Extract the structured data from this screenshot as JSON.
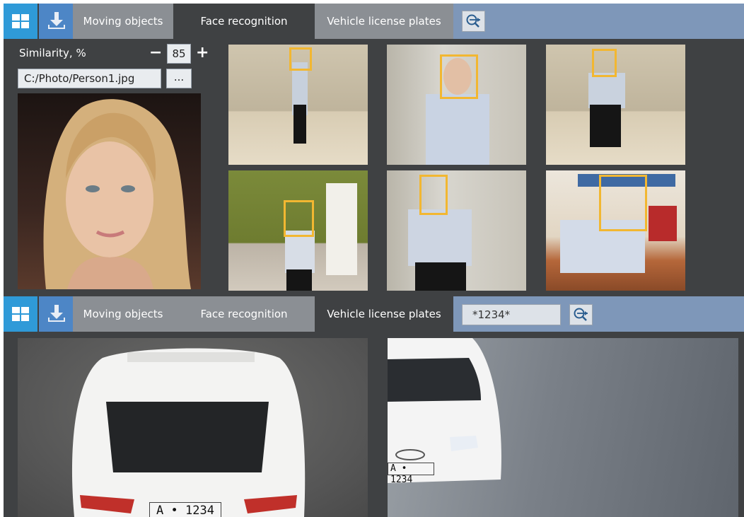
{
  "panel_top": {
    "tabs": [
      {
        "label": "Moving objects"
      },
      {
        "label": "Face recognition"
      },
      {
        "label": "Vehicle license plates"
      }
    ],
    "active_tab": "Face recognition"
  },
  "face_search": {
    "similarity_label": "Similarity, %",
    "similarity_value": "85",
    "minus": "−",
    "plus": "+",
    "file_path": "C:/Photo/Person1.jpg",
    "browse_label": "..."
  },
  "panel_bottom": {
    "tabs": [
      {
        "label": "Moving objects"
      },
      {
        "label": "Face recognition"
      },
      {
        "label": "Vehicle license plates"
      }
    ],
    "active_tab": "Vehicle license plates",
    "plate_query": "*1234*"
  },
  "plates": {
    "cam1": "A • 1234",
    "cam2": "A • 1234"
  },
  "colors": {
    "toolbar": "#7e97b9",
    "active_tab": "#3f4143",
    "face_box": "#f2b731",
    "grid_button": "#2f9ad8"
  },
  "icons": {
    "layout": "grid-icon",
    "export": "download-icon",
    "search": "search-arrow-icon"
  }
}
